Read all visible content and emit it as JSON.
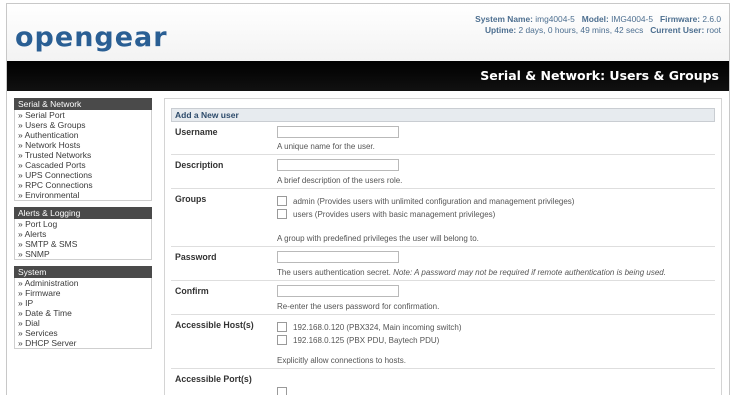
{
  "header": {
    "logo_text": "opengear",
    "system_name_label": "System Name:",
    "system_name_value": "img4004-5",
    "model_label": "Model:",
    "model_value": "IMG4004-5",
    "firmware_label": "Firmware:",
    "firmware_value": "2.6.0",
    "uptime_label": "Uptime:",
    "uptime_value": "2 days, 0 hours, 49 mins, 42 secs",
    "current_user_label": "Current User:",
    "current_user_value": "root"
  },
  "page_title": "Serial & Network: Users & Groups",
  "sidebar": {
    "groups": [
      {
        "title": "Serial & Network",
        "items": [
          "» Serial Port",
          "» Users & Groups",
          "» Authentication",
          "» Network Hosts",
          "» Trusted Networks",
          "» Cascaded Ports",
          "» UPS Connections",
          "» RPC Connections",
          "» Environmental"
        ]
      },
      {
        "title": "Alerts & Logging",
        "items": [
          "» Port Log",
          "» Alerts",
          "» SMTP & SMS",
          "» SNMP"
        ]
      },
      {
        "title": "System",
        "items": [
          "» Administration",
          "» Firmware",
          "» IP",
          "» Date & Time",
          "» Dial",
          "» Services",
          "» DHCP Server"
        ]
      }
    ]
  },
  "form": {
    "section_title": "Add a New user",
    "username": {
      "label": "Username",
      "value": "",
      "help": "A unique name for the user."
    },
    "description": {
      "label": "Description",
      "value": "",
      "help": "A brief description of the users role."
    },
    "groups": {
      "label": "Groups",
      "options": [
        {
          "text": "admin (Provides users with unlimited configuration and management privileges)",
          "checked": false
        },
        {
          "text": "users (Provides users with basic management privileges)",
          "checked": false
        }
      ],
      "help": "A group with predefined privileges the user will belong to."
    },
    "password": {
      "label": "Password",
      "value": "",
      "help": "The users authentication secret.",
      "note": "Note: A password may not be required if remote authentication is being used."
    },
    "confirm": {
      "label": "Confirm",
      "value": "",
      "help": "Re-enter the users password for confirmation."
    },
    "hosts": {
      "label": "Accessible Host(s)",
      "options": [
        {
          "text": "192.168.0.120 (PBX324, Main incoming switch)",
          "checked": false
        },
        {
          "text": "192.168.0.125 (PBX PDU, Baytech PDU)",
          "checked": false
        }
      ],
      "help": "Explicitly allow connections to hosts."
    },
    "ports": {
      "label": "Accessible Port(s)"
    }
  }
}
